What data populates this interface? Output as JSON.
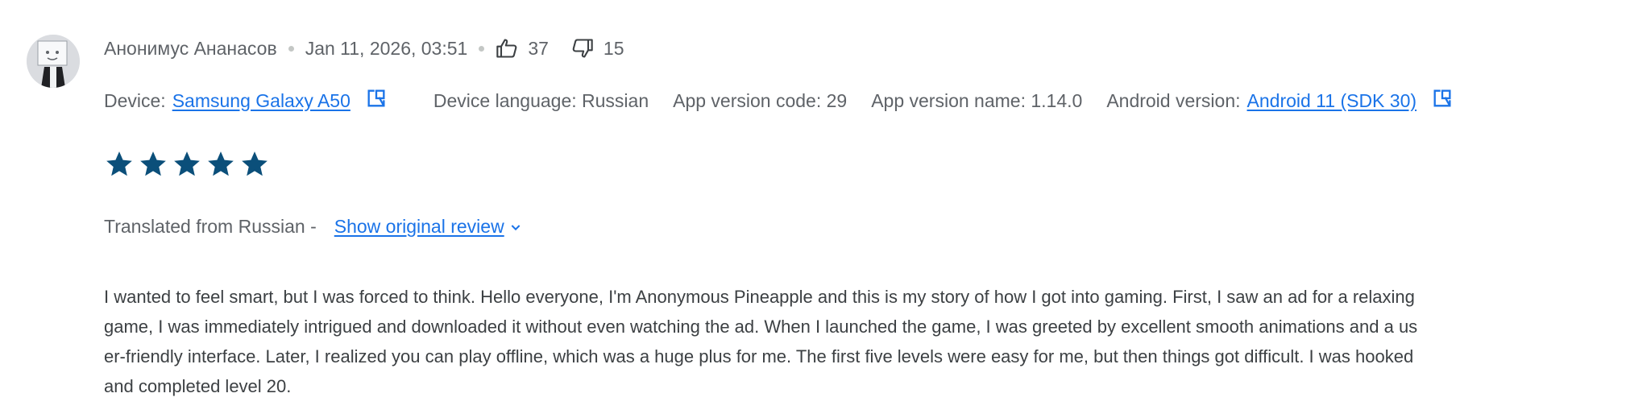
{
  "review": {
    "author": "Анонимус Ананасов",
    "date": "Jan 11, 2026, 03:51",
    "likes": "37",
    "dislikes": "15",
    "rating": 5,
    "rating_max": 5,
    "star_color": "#0b4f7a",
    "device": {
      "label": "Device:",
      "value": "Samsung Galaxy A50",
      "language": "Device language: Russian",
      "app_version_code": "App version code: 29",
      "app_version_name": "App version name: 1.14.0",
      "android_label": "Android version:",
      "android_value": "Android 11 (SDK 30)"
    },
    "translated_from": "Translated from Russian -",
    "show_original": "Show original review",
    "text": "I wanted to feel smart, but I was forced to think. Hello everyone, I'm Anonymous Pineapple and this is my story of how I got into gaming. First, I saw an ad for a relaxing game, I was immediately intrigued and downloaded it without even watching the ad. When I launched the game, I was greeted by excellent smooth animations and a user-friendly interface. Later, I realized you can play offline, which was a huge plus for me. The first five levels were easy for me, but then things got difficult. I was hooked and completed level 20."
  },
  "icons": {
    "avatar": "user-avatar-icon",
    "thumbs_up": "thumbs-up-icon",
    "thumbs_down": "thumbs-down-icon",
    "external": "open-in-new-icon",
    "chevron": "chevron-down-icon",
    "star": "star-icon"
  },
  "colors": {
    "link": "#1a73e8",
    "secondary_text": "#5f6368",
    "body_text": "#3c4043"
  }
}
